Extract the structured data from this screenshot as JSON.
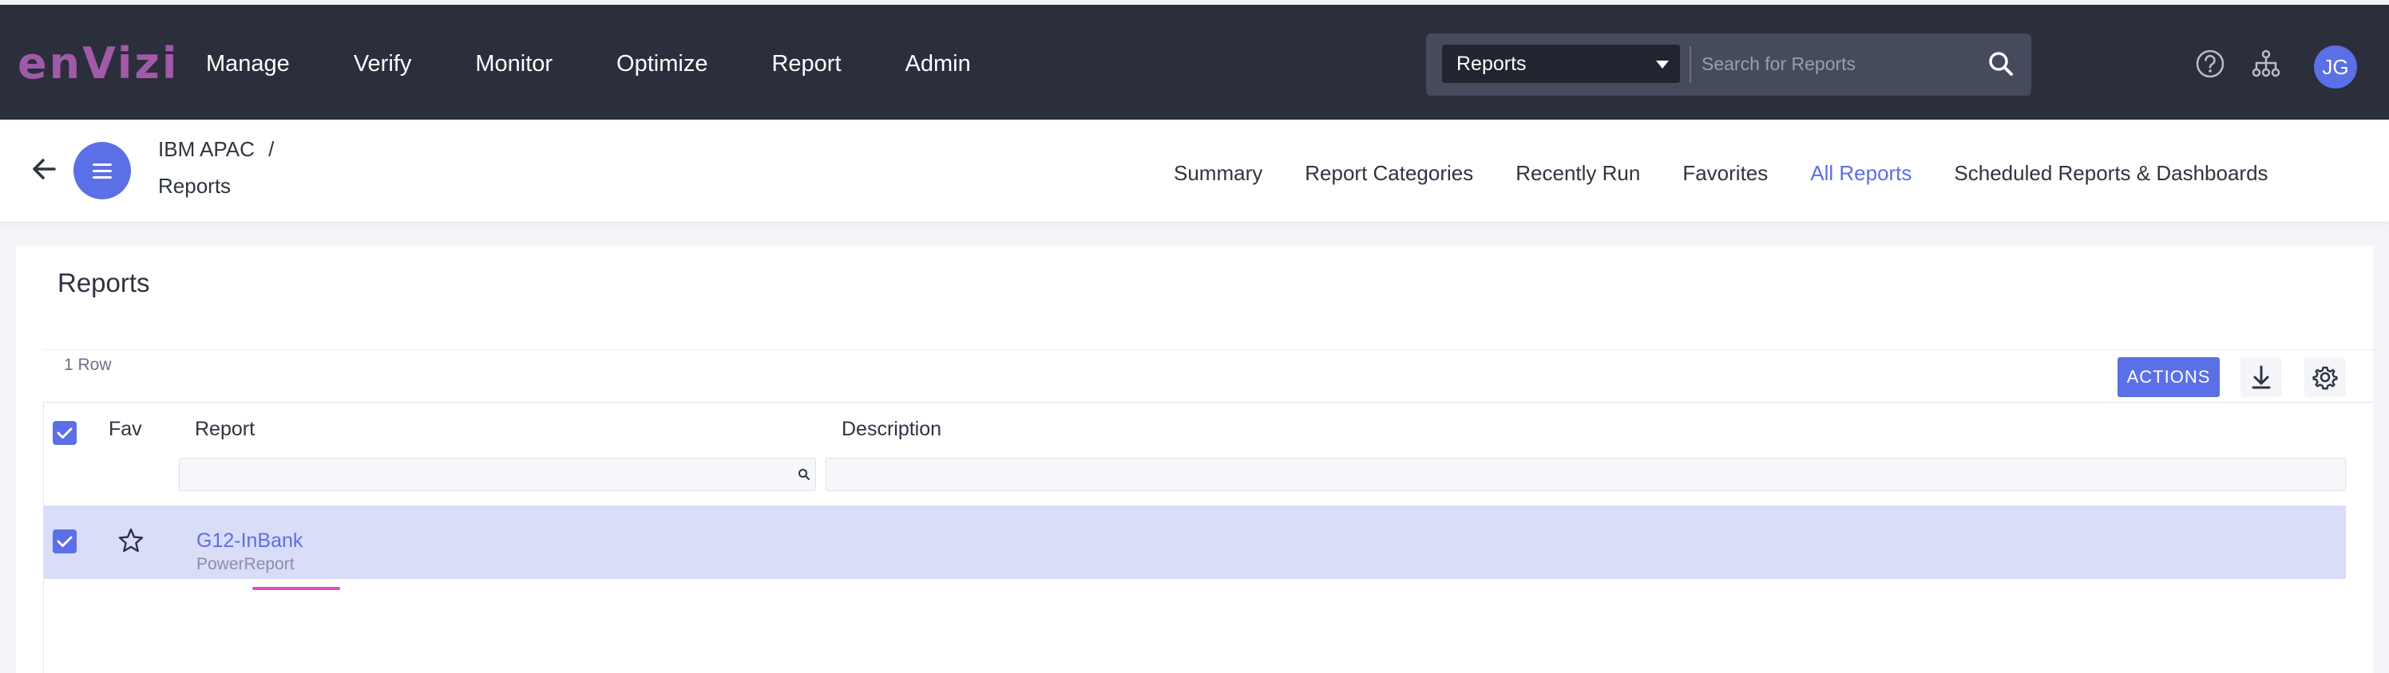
{
  "header": {
    "logo": "enVizi",
    "nav": [
      "Manage",
      "Verify",
      "Monitor",
      "Optimize",
      "Report",
      "Admin"
    ],
    "search": {
      "scope": "Reports",
      "placeholder": "Search for Reports"
    },
    "user_initials": "JG"
  },
  "subheader": {
    "breadcrumb_org": "IBM APAC",
    "breadcrumb_sep": "/",
    "breadcrumb_page": "Reports",
    "tabs": [
      {
        "label": "Summary"
      },
      {
        "label": "Report Categories"
      },
      {
        "label": "Recently Run"
      },
      {
        "label": "Favorites"
      },
      {
        "label": "All Reports"
      },
      {
        "label": "Scheduled Reports & Dashboards"
      }
    ],
    "active_tab": "All Reports"
  },
  "main": {
    "title": "Reports",
    "row_count": "1 Row",
    "actions_label": "ACTIONS",
    "columns": {
      "fav": "Fav",
      "report": "Report",
      "description": "Description"
    },
    "rows": [
      {
        "name": "G12-InBank",
        "type": "PowerReport",
        "description": "",
        "selected": true,
        "favorite": false
      }
    ]
  },
  "colors": {
    "accent": "#5b6fe6",
    "topbar": "#2b2e3b",
    "logo": "#a05aa8",
    "row_selected": "#d9ddf8"
  }
}
